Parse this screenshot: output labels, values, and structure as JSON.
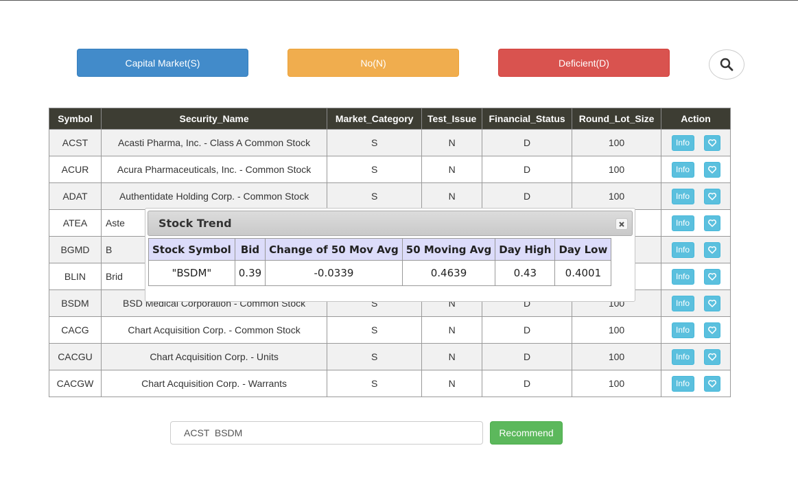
{
  "filters": {
    "capital_market": "Capital Market(S)",
    "no": "No(N)",
    "deficient": "Deficient(D)"
  },
  "colors": {
    "primary": "#428bca",
    "warning": "#f0ad4e",
    "danger": "#d9534f",
    "info": "#5bc0de",
    "success": "#5cb85c",
    "table_header": "#3d3d33",
    "dialog_header": "#dcdcfa"
  },
  "icons": {
    "search": "magnifier",
    "heart": "heart-outline",
    "close": "x"
  },
  "table": {
    "headers": [
      "Symbol",
      "Security_Name",
      "Market_Category",
      "Test_Issue",
      "Financial_Status",
      "Round_Lot_Size",
      "Action"
    ],
    "info_label": "Info",
    "rows": [
      {
        "symbol": "ACST",
        "name": "Acasti Pharma, Inc. - Class A Common Stock",
        "market": "S",
        "test": "N",
        "financial": "D",
        "lot": "100"
      },
      {
        "symbol": "ACUR",
        "name": "Acura Pharmaceuticals, Inc. - Common Stock",
        "market": "S",
        "test": "N",
        "financial": "D",
        "lot": "100"
      },
      {
        "symbol": "ADAT",
        "name": "Authentidate Holding Corp. - Common Stock",
        "market": "S",
        "test": "N",
        "financial": "D",
        "lot": "100"
      },
      {
        "symbol": "ATEA",
        "name": "Aste",
        "market": "",
        "test": "",
        "financial": "",
        "lot": ""
      },
      {
        "symbol": "BGMD",
        "name": "B",
        "market": "",
        "test": "",
        "financial": "",
        "lot": ""
      },
      {
        "symbol": "BLIN",
        "name": "Brid",
        "market": "",
        "test": "",
        "financial": "",
        "lot": ""
      },
      {
        "symbol": "BSDM",
        "name": "BSD Medical Corporation - Common Stock",
        "market": "S",
        "test": "N",
        "financial": "D",
        "lot": "100"
      },
      {
        "symbol": "CACG",
        "name": "Chart Acquisition Corp. - Common Stock",
        "market": "S",
        "test": "N",
        "financial": "D",
        "lot": "100"
      },
      {
        "symbol": "CACGU",
        "name": "Chart Acquisition Corp. - Units",
        "market": "S",
        "test": "N",
        "financial": "D",
        "lot": "100"
      },
      {
        "symbol": "CACGW",
        "name": "Chart Acquisition Corp. - Warrants",
        "market": "S",
        "test": "N",
        "financial": "D",
        "lot": "100"
      }
    ]
  },
  "dialog": {
    "title": "Stock Trend",
    "headers": [
      "Stock Symbol",
      "Bid",
      "Change of 50 Mov Avg",
      "50 Moving Avg",
      "Day High",
      "Day Low"
    ],
    "row": [
      "\"BSDM\"",
      "0.39",
      "-0.0339",
      "0.4639",
      "0.43",
      "0.4001"
    ]
  },
  "recommend": {
    "input_value": "ACST  BSDM",
    "button_label": "Recommend"
  }
}
